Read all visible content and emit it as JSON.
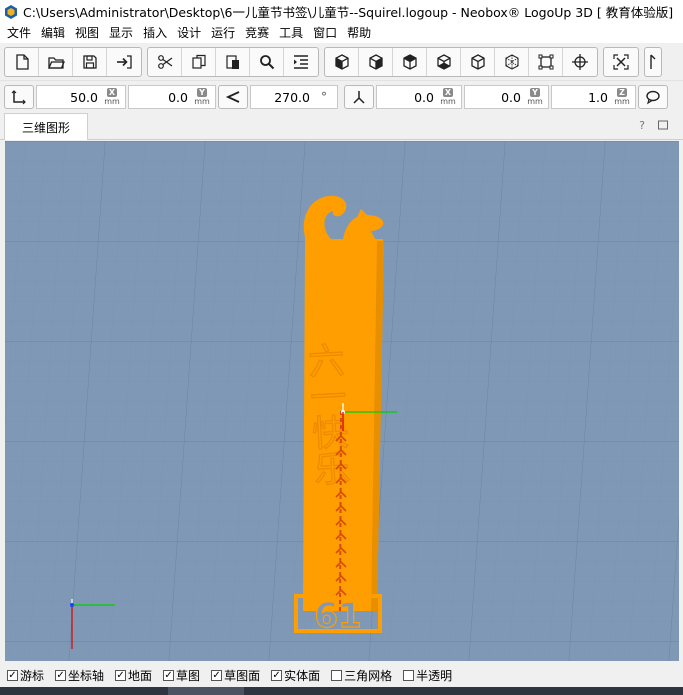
{
  "window": {
    "title": "C:\\Users\\Administrator\\Desktop\\6一儿童节书签\\儿童节--Squirel.logoup - Neobox® LogoUp 3D [ 教育体验版]"
  },
  "menu": [
    "文件",
    "编辑",
    "视图",
    "显示",
    "插入",
    "设计",
    "运行",
    "竞赛",
    "工具",
    "窗口",
    "帮助"
  ],
  "toolbar_groups": [
    [
      "new-file-icon",
      "open-folder-icon",
      "save-icon",
      "import-icon"
    ],
    [
      "cut-icon",
      "copy-icon",
      "paste-icon",
      "search-icon",
      "indent-icon"
    ],
    [
      "cube-view-1-icon",
      "cube-view-2-icon",
      "cube-view-3-icon",
      "cube-view-4-icon",
      "cube-view-5-icon",
      "cube-wire-icon",
      "fit-frame-icon",
      "axis-target-icon"
    ],
    [
      "reset-icon"
    ],
    [
      "pointer-icon"
    ]
  ],
  "coords": {
    "x": {
      "value": "50.0",
      "axis": "X",
      "unit": "mm"
    },
    "y": {
      "value": "0.0",
      "axis": "Y",
      "unit": "mm"
    },
    "angle": {
      "value": "270.0",
      "unit": "°"
    },
    "px": {
      "value": "0.0",
      "axis": "X",
      "unit": "mm"
    },
    "py": {
      "value": "0.0",
      "axis": "Y",
      "unit": "mm"
    },
    "scale": {
      "value": "1.0",
      "axis": "Z",
      "unit": "mm"
    }
  },
  "tab": {
    "label": "三维图形"
  },
  "model": {
    "vertical_text": "六一快乐",
    "base_text": "61",
    "color": "#ff9e00"
  },
  "status": [
    {
      "label": "游标",
      "checked": true
    },
    {
      "label": "坐标轴",
      "checked": true
    },
    {
      "label": "地面",
      "checked": true
    },
    {
      "label": "草图",
      "checked": true
    },
    {
      "label": "草图面",
      "checked": true
    },
    {
      "label": "实体面",
      "checked": true
    },
    {
      "label": "三角网格",
      "checked": false
    },
    {
      "label": "半透明",
      "checked": false
    }
  ],
  "colors": {
    "viewport_bg": "#7f98b6",
    "grid": "#6d86a4",
    "accent_orange": "#ff9e00",
    "axis_green": "#00d000",
    "axis_red": "#e00000"
  }
}
